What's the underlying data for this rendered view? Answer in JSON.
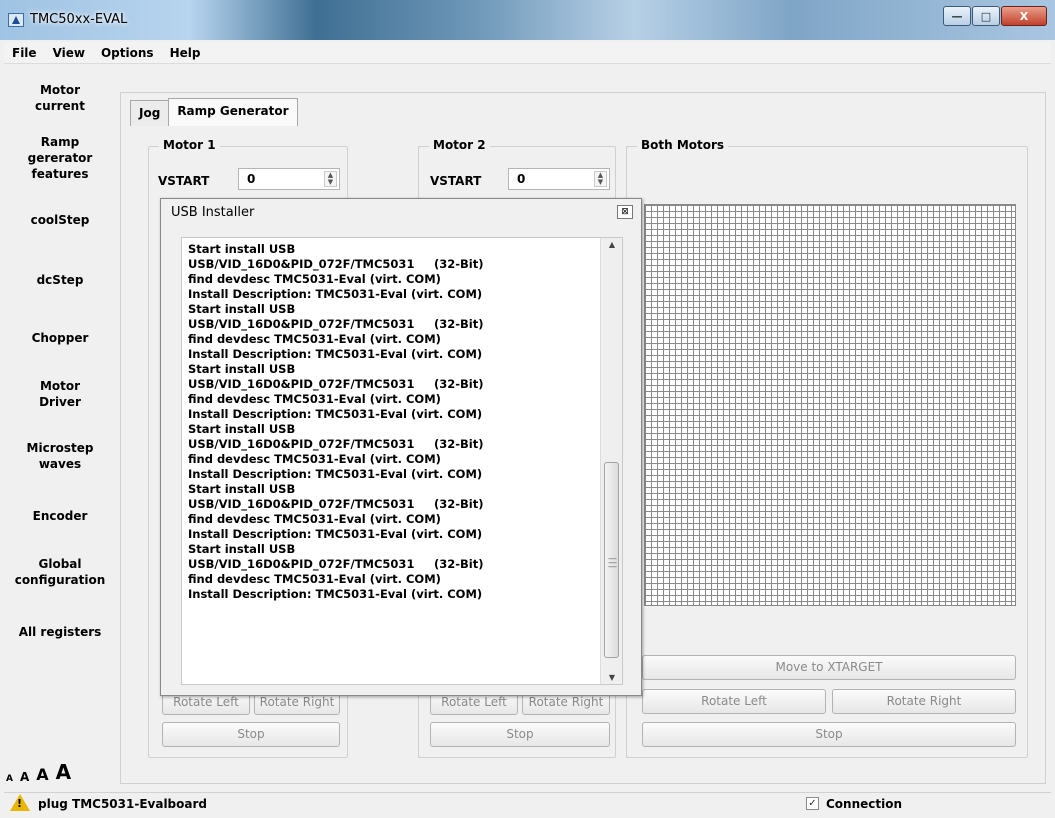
{
  "window": {
    "title": "TMC50xx-EVAL",
    "minimize": "—",
    "maximize": "□",
    "close": "X"
  },
  "menu": [
    "File",
    "View",
    "Options",
    "Help"
  ],
  "sidebar": [
    {
      "label": "Motor\ncurrent"
    },
    {
      "label": "Ramp\ngererator\nfeatures"
    },
    {
      "label": "coolStep"
    },
    {
      "label": "dcStep"
    },
    {
      "label": "Chopper"
    },
    {
      "label": "Motor\nDriver"
    },
    {
      "label": "Microstep\nwaves"
    },
    {
      "label": "Encoder"
    },
    {
      "label": "Global\nconfiguration"
    },
    {
      "label": "All registers"
    }
  ],
  "font_sizes": [
    "A",
    "A",
    "A",
    "A"
  ],
  "tabs": [
    {
      "label": "Jog",
      "active": false
    },
    {
      "label": "Ramp Generator",
      "active": true
    }
  ],
  "motor1": {
    "title": "Motor 1",
    "vstart_label": "VSTART",
    "vstart_value": "0",
    "rotate_left": "Rotate Left",
    "rotate_right": "Rotate Right",
    "stop": "Stop"
  },
  "motor2": {
    "title": "Motor 2",
    "vstart_label": "VSTART",
    "vstart_value": "0",
    "rotate_left": "Rotate Left",
    "rotate_right": "Rotate Right",
    "stop": "Stop"
  },
  "both_motors": {
    "title": "Both Motors",
    "move_to_xtarget": "Move to XTARGET",
    "rotate_left": "Rotate Left",
    "rotate_right": "Rotate Right",
    "stop": "Stop"
  },
  "dialog": {
    "title": "USB Installer",
    "close": "⊠",
    "lines": [
      {
        "text": "Start install USB",
        "bits": ""
      },
      {
        "text": "USB/VID_16D0&PID_072F/TMC5031",
        "bits": "(32-Bit)"
      },
      {
        "text": "find devdesc TMC5031-Eval (virt. COM)",
        "bits": ""
      },
      {
        "text": "Install Description: TMC5031-Eval (virt. COM)",
        "bits": ""
      },
      {
        "text": "Start install USB",
        "bits": ""
      },
      {
        "text": "USB/VID_16D0&PID_072F/TMC5031",
        "bits": "(32-Bit)"
      },
      {
        "text": "find devdesc TMC5031-Eval (virt. COM)",
        "bits": ""
      },
      {
        "text": "Install Description: TMC5031-Eval (virt. COM)",
        "bits": ""
      },
      {
        "text": "Start install USB",
        "bits": ""
      },
      {
        "text": "USB/VID_16D0&PID_072F/TMC5031",
        "bits": "(32-Bit)"
      },
      {
        "text": "find devdesc TMC5031-Eval (virt. COM)",
        "bits": ""
      },
      {
        "text": "Install Description: TMC5031-Eval (virt. COM)",
        "bits": ""
      },
      {
        "text": "Start install USB",
        "bits": ""
      },
      {
        "text": "USB/VID_16D0&PID_072F/TMC5031",
        "bits": "(32-Bit)"
      },
      {
        "text": "find devdesc TMC5031-Eval (virt. COM)",
        "bits": ""
      },
      {
        "text": "Install Description: TMC5031-Eval (virt. COM)",
        "bits": ""
      },
      {
        "text": "Start install USB",
        "bits": ""
      },
      {
        "text": "USB/VID_16D0&PID_072F/TMC5031",
        "bits": "(32-Bit)"
      },
      {
        "text": "find devdesc TMC5031-Eval (virt. COM)",
        "bits": ""
      },
      {
        "text": "Install Description: TMC5031-Eval (virt. COM)",
        "bits": ""
      },
      {
        "text": "Start install USB",
        "bits": ""
      },
      {
        "text": "USB/VID_16D0&PID_072F/TMC5031",
        "bits": "(32-Bit)"
      },
      {
        "text": "find devdesc TMC5031-Eval (virt. COM)",
        "bits": ""
      },
      {
        "text": "Install Description: TMC5031-Eval (virt. COM)",
        "bits": ""
      }
    ]
  },
  "status": {
    "message": "plug TMC5031-Evalboard",
    "warning_glyph": "!",
    "connection_label": "Connection",
    "connection_checked": true
  }
}
